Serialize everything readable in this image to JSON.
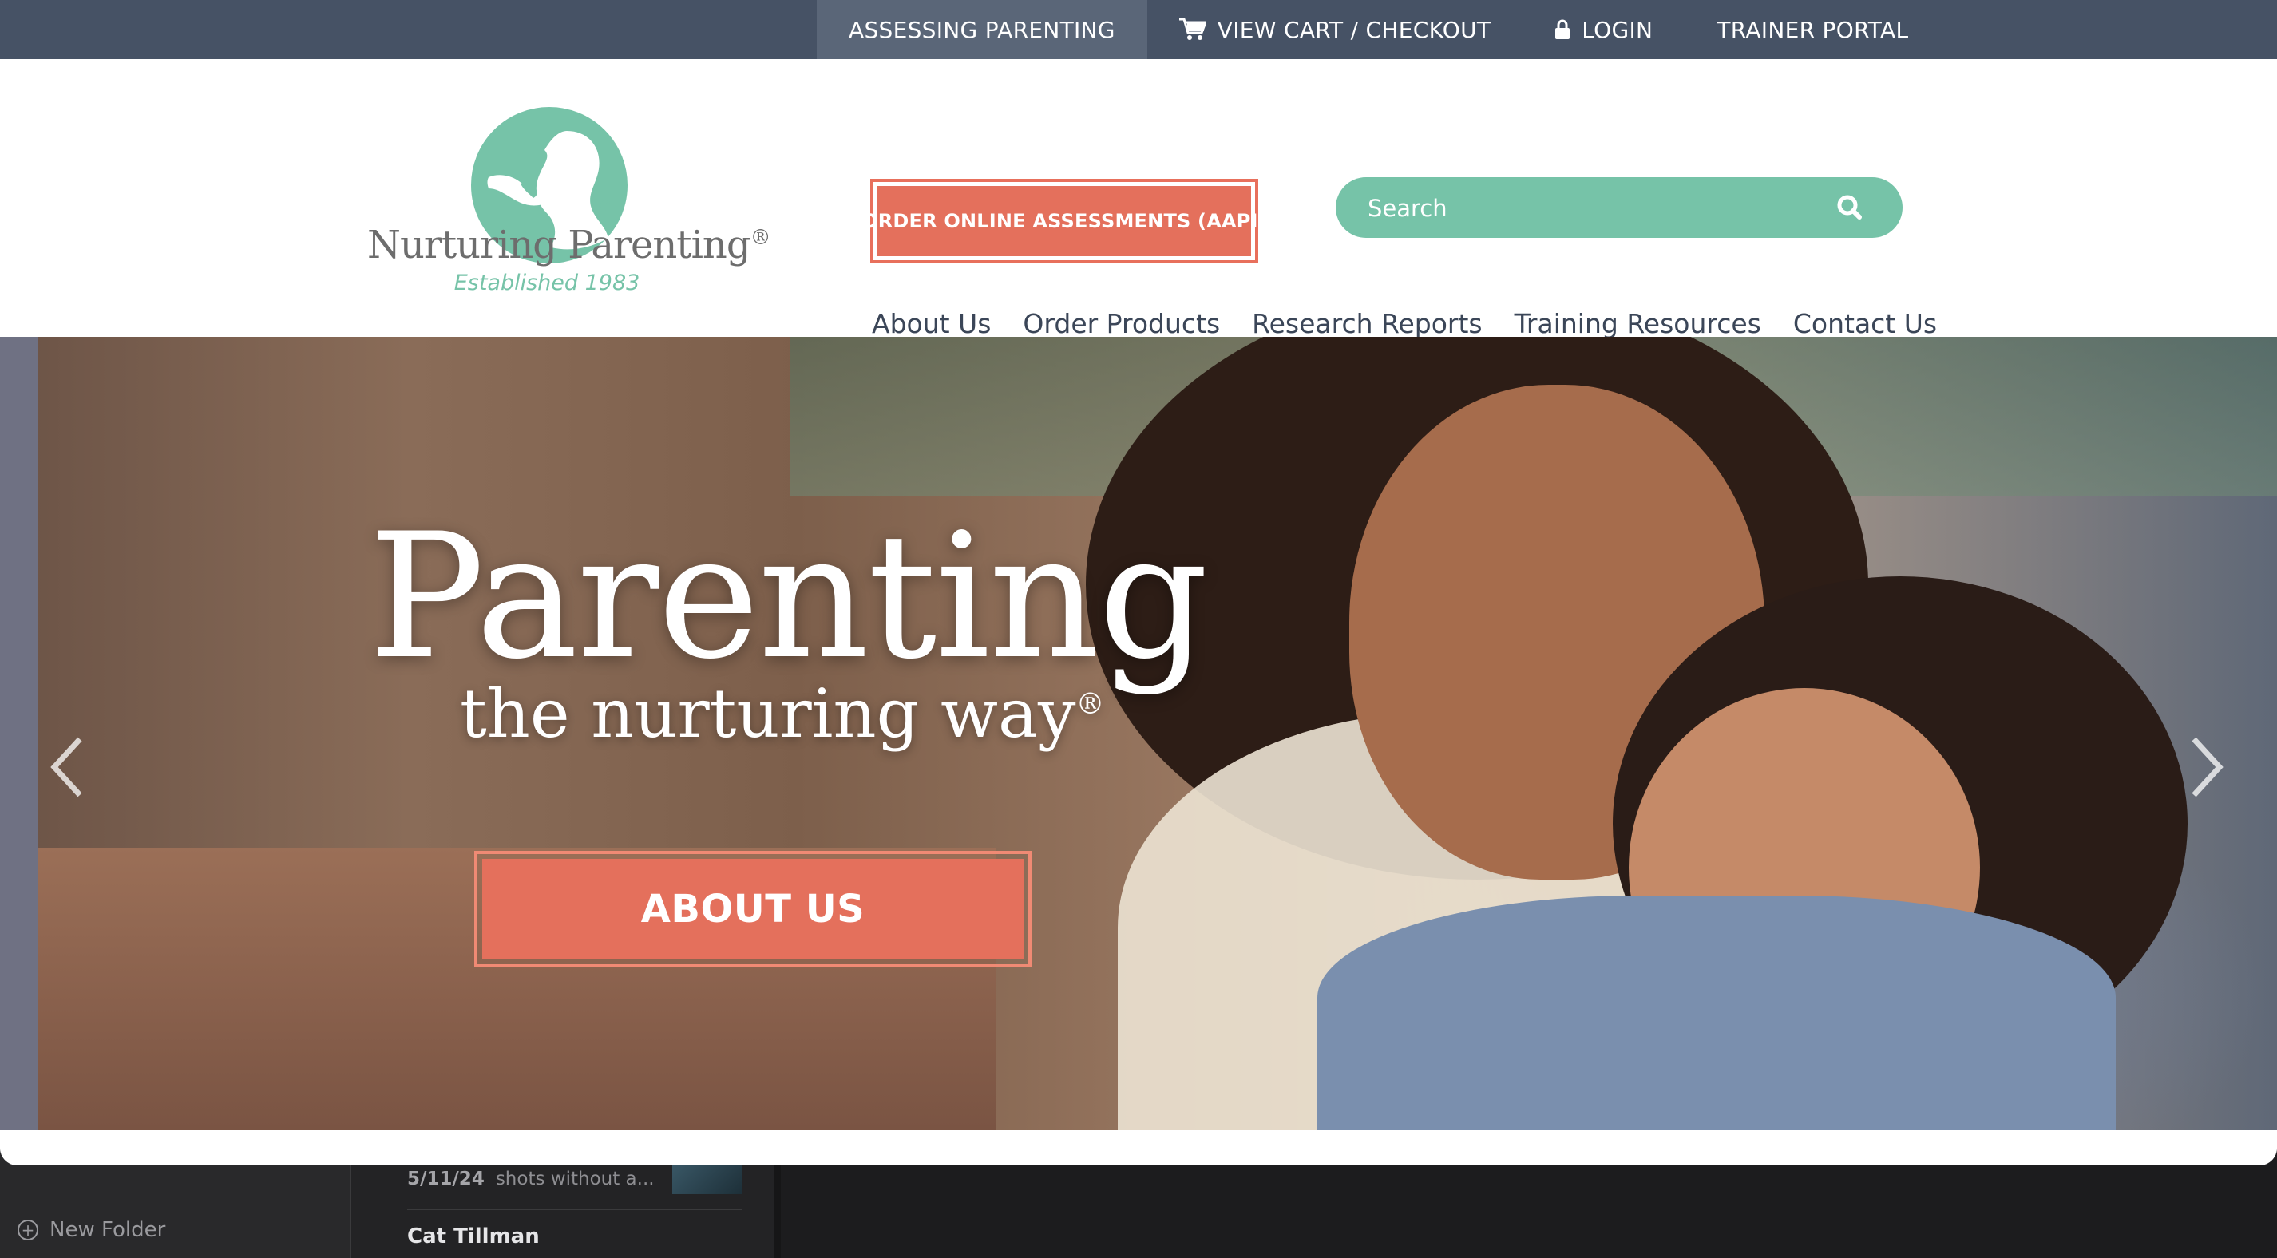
{
  "top_nav": {
    "items": [
      {
        "label": "ASSESSING PARENTING",
        "icon": ""
      },
      {
        "label": "VIEW CART / CHECKOUT",
        "icon": "cart-icon"
      },
      {
        "label": "LOGIN",
        "icon": "lock-icon"
      },
      {
        "label": "TRAINER PORTAL",
        "icon": ""
      }
    ]
  },
  "logo": {
    "name": "Nurturing Parenting",
    "registered": "®",
    "tagline": "Established 1983"
  },
  "order_button": "ORDER ONLINE ASSESSMENTS (AAPI)",
  "search": {
    "placeholder": "Search",
    "icon": "search-icon"
  },
  "main_nav": [
    "About Us",
    "Order Products",
    "Research Reports",
    "Training Resources",
    "Contact Us"
  ],
  "hero": {
    "title": "Parenting",
    "subtitle": "the nurturing way",
    "subtitle_mark": "®",
    "button": "ABOUT US"
  },
  "colors": {
    "accent_green": "#76c3a8",
    "accent_coral": "#e4705c",
    "topbar": "#465265"
  },
  "background_app": {
    "folder_action": "New Folder",
    "row_date": "5/11/24",
    "row_preview": "shots without a...",
    "sender": "Cat Tillman"
  }
}
